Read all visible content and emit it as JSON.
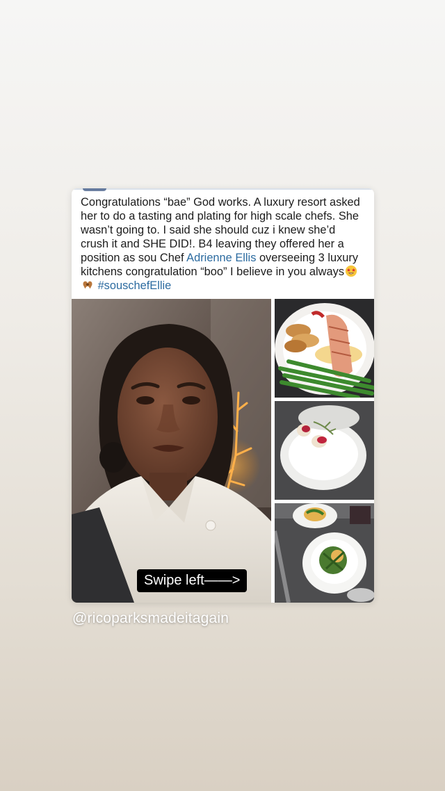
{
  "post": {
    "caption_main": "Congratulations “bae” God works. A luxury resort asked her to do a tasting and plating for high scale chefs. She wasn’t going to. I said she should cuz i knew she’d crush it and SHE DID!. B4 leaving they offered her a position as sou Chef ",
    "mention_link": "Adrienne Ellis",
    "caption_after": " overseeing 3 luxury kitchens congratulation “boo” I believe in you always",
    "emojis": [
      "star-struck-face",
      "heart-hands"
    ],
    "hashtag": "#souschefEllie",
    "swipe_label": "Swipe left——>"
  },
  "story": {
    "mention": "@ricoparksmadeitagain"
  },
  "colors": {
    "link": "#2c6ba0",
    "swipe_bg": "#000000"
  }
}
